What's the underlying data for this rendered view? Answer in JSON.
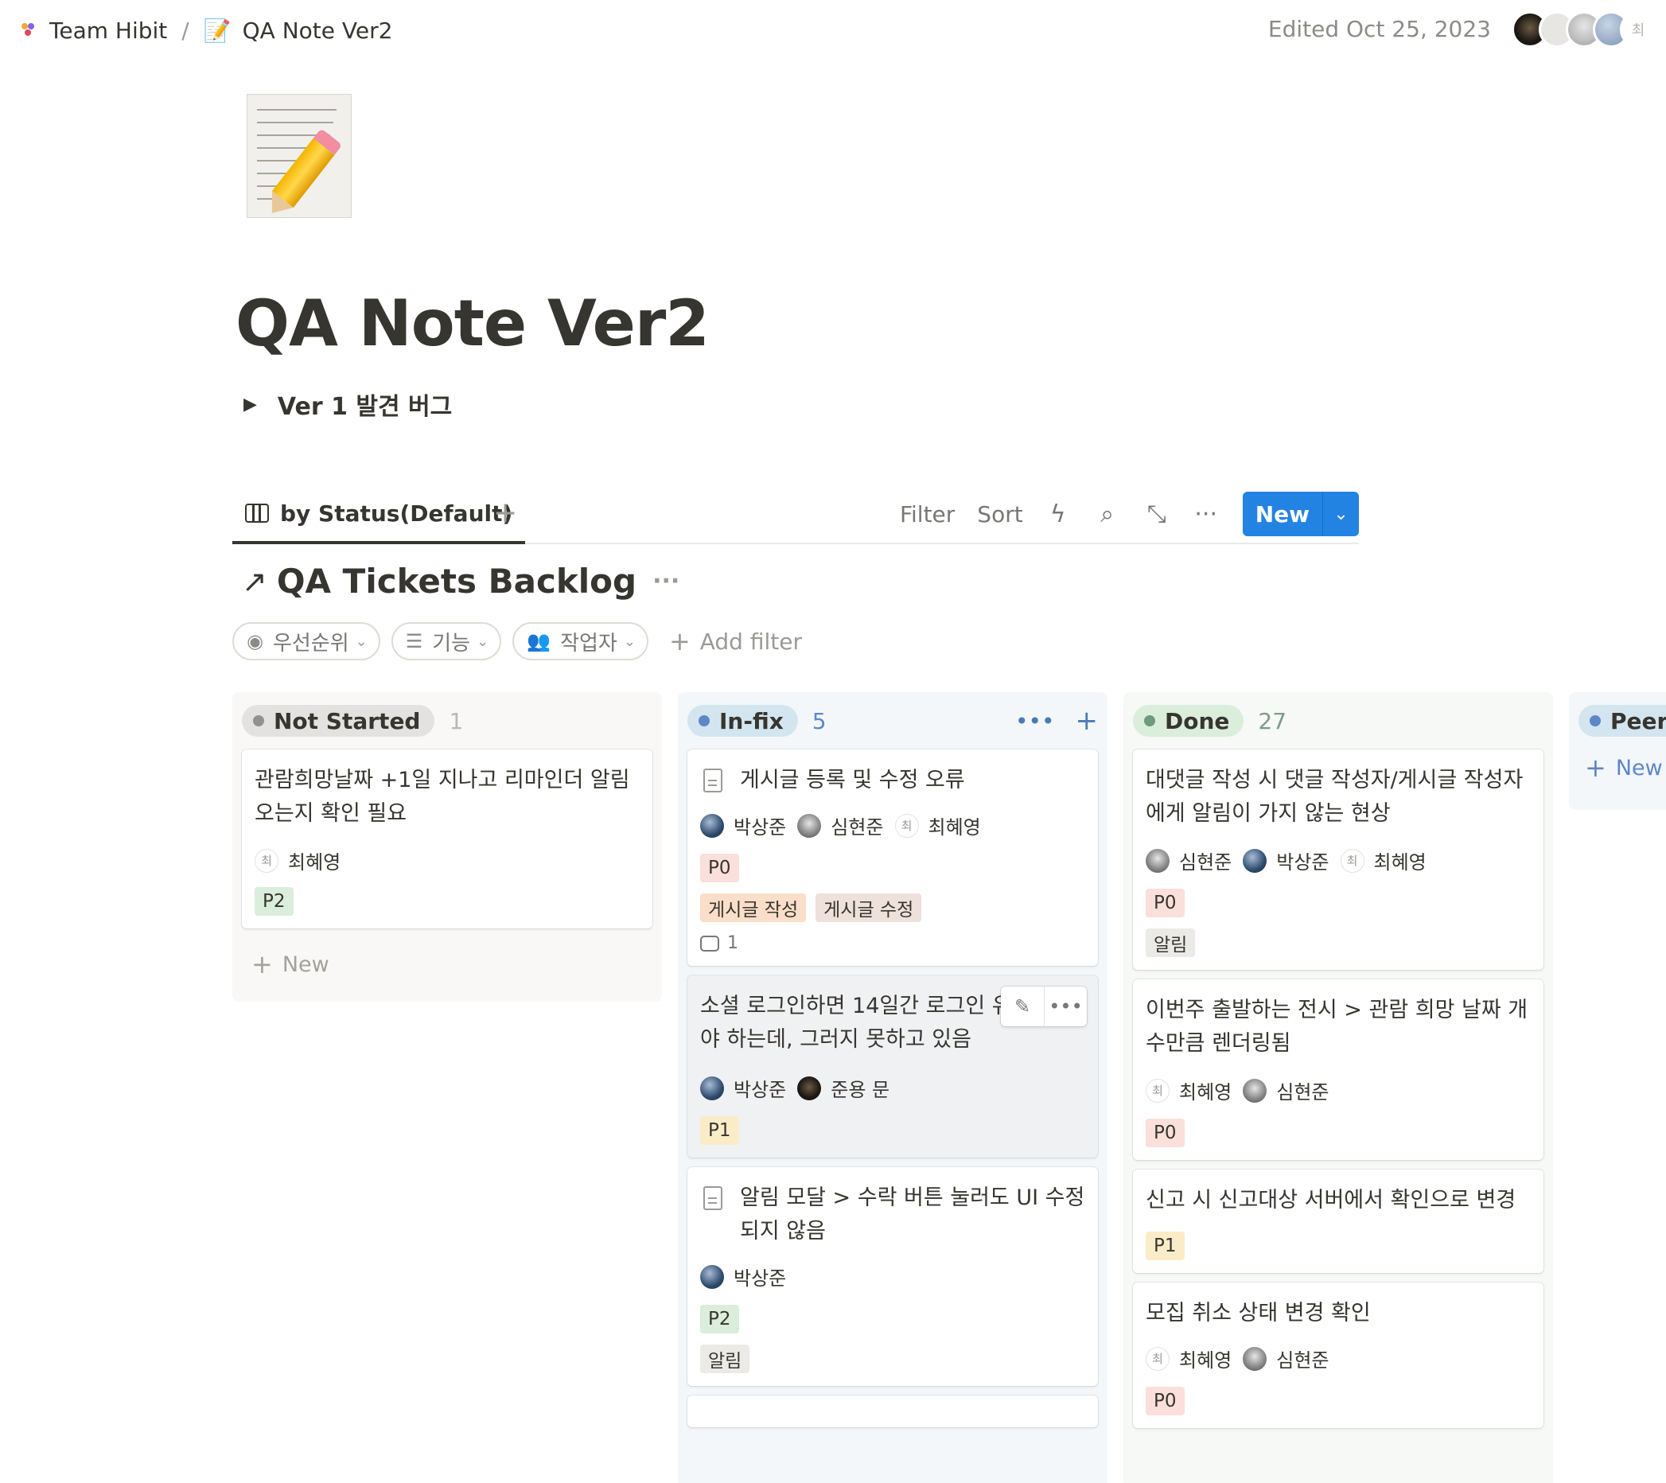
{
  "breadcrumb": {
    "workspace": "Team Hibit",
    "separator": "/",
    "page_icon": "memo-emoji",
    "page": "QA Note Ver2"
  },
  "edited": "Edited Oct 25, 2023",
  "avatar_stack": {
    "last_initial": "최"
  },
  "page": {
    "title": "QA Note Ver2",
    "toggle_label": "Ver 1 발견 버그"
  },
  "view": {
    "tab_label": "by Status(Default)",
    "filter_label": "Filter",
    "sort_label": "Sort",
    "new_label": "New"
  },
  "database": {
    "title": "QA Tickets Backlog",
    "filters": [
      {
        "label": "우선순위",
        "icon": "priority-circle-icon"
      },
      {
        "label": "기능",
        "icon": "list-icon"
      },
      {
        "label": "작업자",
        "icon": "people-icon"
      }
    ],
    "add_filter": "Add filter",
    "new_card": "New"
  },
  "colors": {
    "accent": "#2383e2",
    "not_started_bg": "#f9f8f7",
    "in_fix_bg": "#f4f7fa",
    "done_bg": "#f6f9f6",
    "p0": "#fadfdb",
    "p1": "#fbecc8",
    "p2": "#dbeddb",
    "feature_orange": "#fadec9",
    "feature_brown": "#eee0da",
    "feature_gray": "#ebeae7"
  },
  "columns": [
    {
      "status": "Not Started",
      "count": "1",
      "cards": [
        {
          "title": "관람희망날짜 +1일 지나고 리마인더 알림 오는지 확인 필요",
          "people": [
            {
              "name": "최혜영",
              "initial": "최"
            }
          ],
          "priority": "P2"
        }
      ]
    },
    {
      "status": "In-fix",
      "count": "5",
      "cards": [
        {
          "title": "게시글 등록 및 수정 오류",
          "people": [
            {
              "name": "박상준"
            },
            {
              "name": "심현준"
            },
            {
              "name": "최혜영",
              "initial": "최"
            }
          ],
          "priority": "P0",
          "features": [
            "게시글 작성",
            "게시글 수정"
          ],
          "comments": "1"
        },
        {
          "title": "소셜 로그인하면 14일간 로그인 유지되어야 하는데, 그러지 못하고 있음",
          "people": [
            {
              "name": "박상준"
            },
            {
              "name": "준용 문"
            }
          ],
          "priority": "P1"
        },
        {
          "title": "알림 모달 > 수락 버튼 눌러도 UI 수정 되지 않음",
          "people": [
            {
              "name": "박상준"
            }
          ],
          "priority": "P2",
          "features": [
            "알림"
          ]
        }
      ]
    },
    {
      "status": "Done",
      "count": "27",
      "cards": [
        {
          "title": "대댓글 작성 시 댓글 작성자/게시글 작성자에게 알림이 가지 않는 현상",
          "people": [
            {
              "name": "심현준"
            },
            {
              "name": "박상준"
            },
            {
              "name": "최혜영",
              "initial": "최"
            }
          ],
          "priority": "P0",
          "features": [
            "알림"
          ]
        },
        {
          "title": "이번주 출발하는 전시 > 관람 희망 날짜 개수만큼 렌더링됨",
          "people": [
            {
              "name": "최혜영",
              "initial": "최"
            },
            {
              "name": "심현준"
            }
          ],
          "priority": "P0"
        },
        {
          "title": "신고 시 신고대상 서버에서 확인으로 변경",
          "priority": "P1"
        },
        {
          "title": "모집 취소 상태 변경 확인",
          "people": [
            {
              "name": "최혜영",
              "initial": "최"
            },
            {
              "name": "심현준"
            }
          ],
          "priority": "P0"
        }
      ]
    },
    {
      "status": "Peer-",
      "new_label": "New"
    }
  ]
}
